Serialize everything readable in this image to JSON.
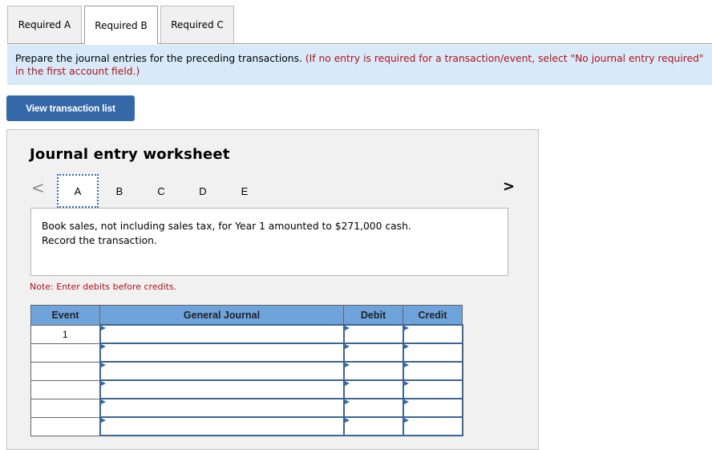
{
  "tabs": [
    {
      "label": "Required A",
      "active": false
    },
    {
      "label": "Required B",
      "active": true
    },
    {
      "label": "Required C",
      "active": false
    }
  ],
  "instructions": {
    "main": "Prepare the journal entries for the preceding transactions. ",
    "note": "(If no entry is required for a transaction/event, select \"No journal entry required\" in the first account field.)"
  },
  "view_button": "View transaction list",
  "worksheet": {
    "title": "Journal entry worksheet",
    "prev_icon": "chevron-left",
    "next_icon": "chevron-right",
    "letters": [
      "A",
      "B",
      "C",
      "D",
      "E"
    ],
    "active_letter": "A",
    "description_line1": "Book sales, not including sales tax, for Year 1 amounted to $271,000 cash.",
    "description_line2": "Record the transaction.",
    "note": "Note: Enter debits before credits."
  },
  "table": {
    "headers": [
      "Event",
      "General Journal",
      "Debit",
      "Credit"
    ],
    "rows": [
      {
        "event": "1",
        "account": "",
        "debit": "",
        "credit": ""
      },
      {
        "event": "",
        "account": "",
        "debit": "",
        "credit": ""
      },
      {
        "event": "",
        "account": "",
        "debit": "",
        "credit": ""
      },
      {
        "event": "",
        "account": "",
        "debit": "",
        "credit": ""
      },
      {
        "event": "",
        "account": "",
        "debit": "",
        "credit": ""
      },
      {
        "event": "",
        "account": "",
        "debit": "",
        "credit": ""
      }
    ]
  }
}
